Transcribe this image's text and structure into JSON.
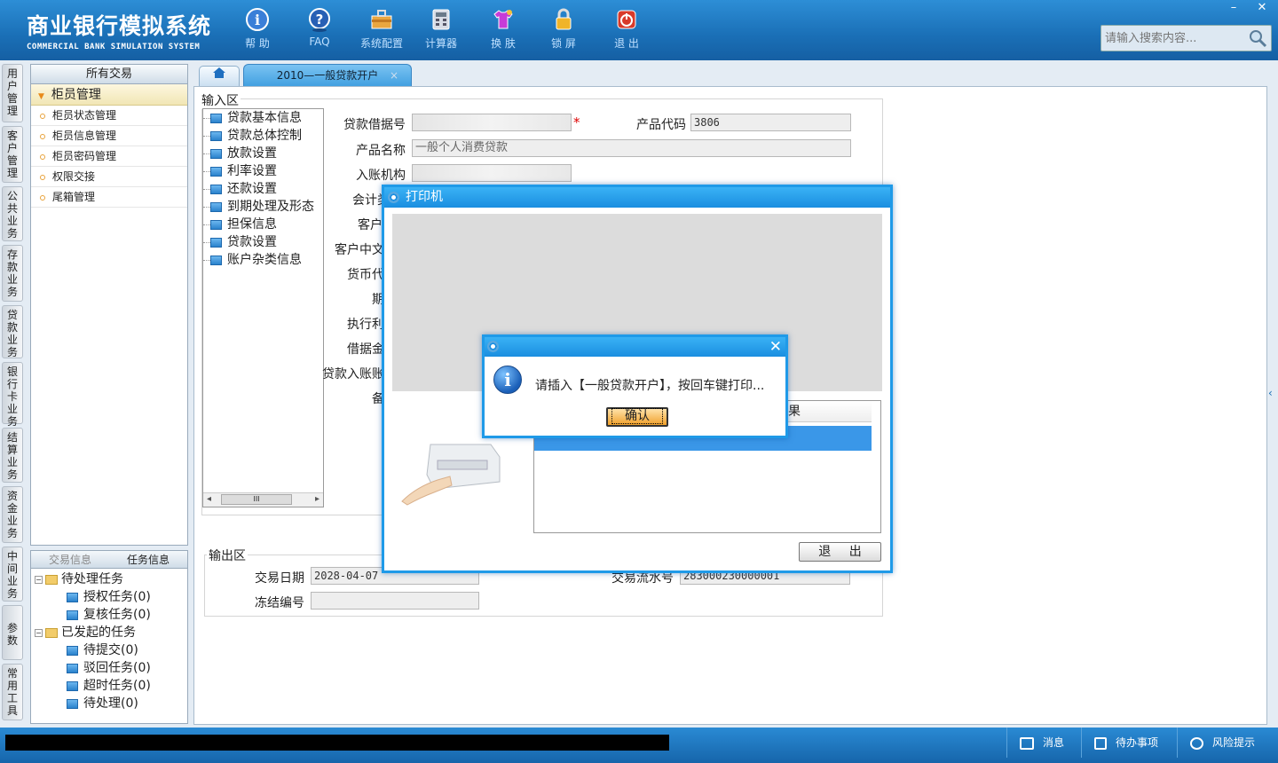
{
  "app": {
    "title_cn": "商业银行模拟系统",
    "title_en": "COMMERCIAL BANK SIMULATION SYSTEM"
  },
  "toolbar": [
    {
      "label": "帮 助",
      "icon": "info-icon"
    },
    {
      "label": "FAQ",
      "icon": "question-icon"
    },
    {
      "label": "系统配置",
      "icon": "toolbox-icon"
    },
    {
      "label": "计算器",
      "icon": "calculator-icon"
    },
    {
      "label": "换 肤",
      "icon": "shirt-icon"
    },
    {
      "label": "锁 屏",
      "icon": "lock-icon"
    },
    {
      "label": "退 出",
      "icon": "power-icon"
    }
  ],
  "window": {
    "minimize": "–",
    "close": "✕"
  },
  "search": {
    "placeholder": "请输入搜索内容..."
  },
  "vnav": [
    "用户管理",
    "客户管理",
    "公共业务",
    "存款业务",
    "贷款业务",
    "银行卡业务",
    "结算业务",
    "资金业务",
    "中间业务",
    "参数",
    "常用工具"
  ],
  "left_panel": {
    "header": "所有交易",
    "group": "柜员管理",
    "items": [
      "柜员状态管理",
      "柜员信息管理",
      "柜员密码管理",
      "权限交接",
      "尾箱管理"
    ]
  },
  "bottom_panel": {
    "tabs": [
      "交易信息",
      "任务信息"
    ],
    "tree": {
      "pending": {
        "label": "待处理任务",
        "children": [
          "授权任务(0)",
          "复核任务(0)"
        ]
      },
      "initiated": {
        "label": "已发起的任务",
        "children": [
          "待提交(0)",
          "驳回任务(0)",
          "超时任务(0)",
          "待处理(0)"
        ]
      }
    }
  },
  "tabs": {
    "active": "2010—一般贷款开户",
    "close": "×"
  },
  "input_area": {
    "title": "输入区",
    "tree": [
      "贷款基本信息",
      "贷款总体控制",
      "放款设置",
      "利率设置",
      "还款设置",
      "到期处理及形态",
      "担保信息",
      "贷款设置",
      "账户杂类信息"
    ],
    "scroll_left": "◂",
    "scroll_thumb": "III",
    "scroll_right": "▸",
    "fields": {
      "loan_no_label": "贷款借据号",
      "loan_no_value": "",
      "product_code_label": "产品代码",
      "product_code_value": "3806",
      "product_name_label": "产品名称",
      "product_name_value": "一般个人消费贷款",
      "org_label": "入账机构",
      "org_value": "",
      "acct_label": "会计类",
      "cust_label": "客户",
      "cust_cn_label": "客户中文",
      "currency_label": "货币代",
      "term_label": "期",
      "exec_label": "执行利",
      "borrow_label": "借据金",
      "loan_acct_label": "贷款入账账",
      "extra_label": "备"
    }
  },
  "output_area": {
    "title": "输出区",
    "date_label": "交易日期",
    "date_value": "2028-04-07",
    "freeze_label": "冻结编号",
    "freeze_value": "",
    "serial_label": "交易流水号",
    "serial_value": "283000230000001"
  },
  "printer_dialog": {
    "title": "打印机",
    "list_header": "果",
    "exit": "退 出"
  },
  "message": {
    "text": "请插入【一般贷款开户】，按回车键打印...",
    "ok": "确认",
    "close": "✕"
  },
  "status_bar": [
    {
      "label": "消息",
      "icon": "mail-icon"
    },
    {
      "label": "待办事项",
      "icon": "checkbox-icon"
    },
    {
      "label": "风险提示",
      "icon": "chat-bubble-icon"
    }
  ]
}
